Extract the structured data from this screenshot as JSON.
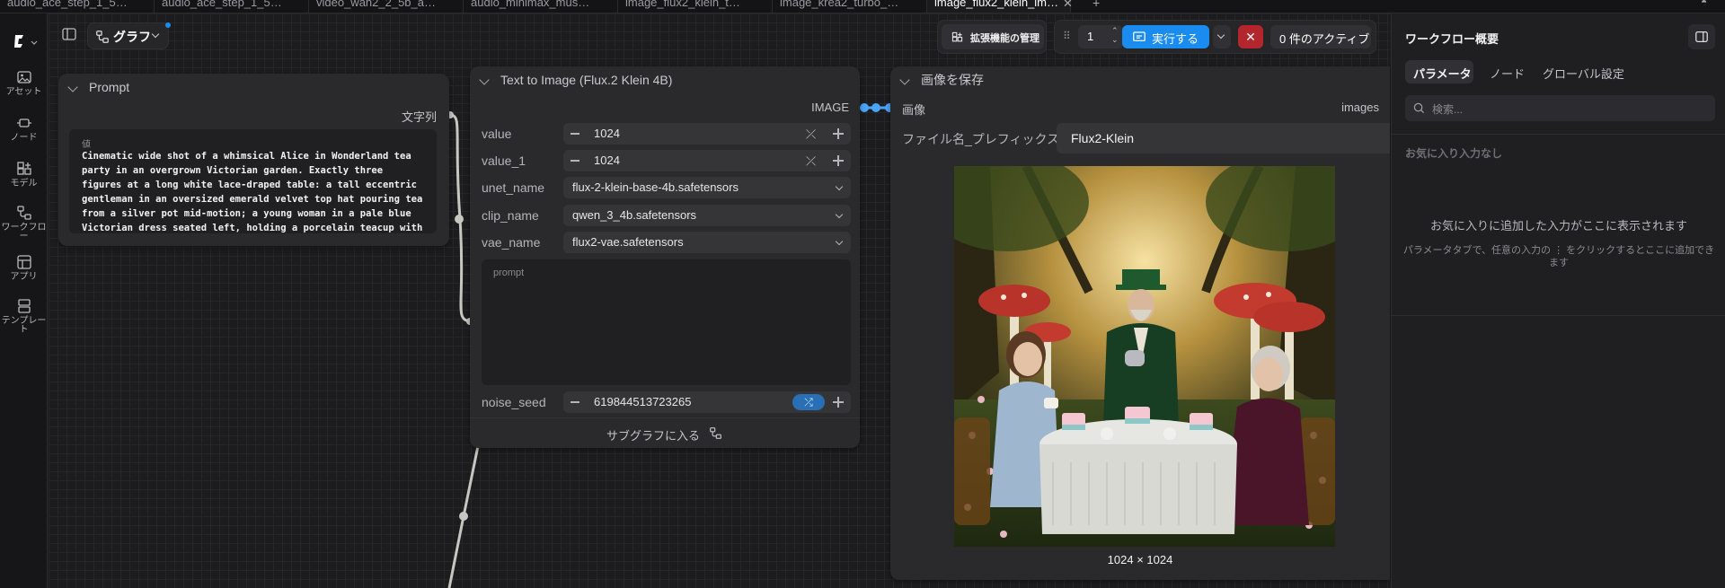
{
  "tabs": [
    {
      "label": "audio_ace_step_1_5…"
    },
    {
      "label": "audio_ace_step_1_5…"
    },
    {
      "label": "video_wan2_2_5b_a…"
    },
    {
      "label": "audio_minimax_mus…"
    },
    {
      "label": "image_flux2_klein_t…"
    },
    {
      "label": "image_krea2_turbo_…"
    },
    {
      "label": "image_flux2_klein_im…"
    }
  ],
  "sidebar": {
    "items": [
      {
        "label": "アセット",
        "icon": "image-icon"
      },
      {
        "label": "ノード",
        "icon": "node-icon"
      },
      {
        "label": "モデル",
        "icon": "model-icon"
      },
      {
        "label": "ワークフロー",
        "icon": "workflow-icon"
      },
      {
        "label": "アプリ",
        "icon": "app-icon"
      },
      {
        "label": "テンプレート",
        "icon": "template-icon"
      }
    ]
  },
  "toolbar": {
    "graph_label": "グラフ",
    "extensions_label": "拡張機能の管理",
    "queue_count": "1",
    "run_label": "実行する",
    "active_label": "0 件のアクティブ"
  },
  "prompt_node": {
    "title": "Prompt",
    "output_label": "文字列",
    "field_label": "値",
    "text": "Cinematic wide shot of a whimsical Alice in Wonderland tea party in an overgrown Victorian garden. Exactly three figures at a long white lace-draped table: a tall eccentric gentleman in an oversized emerald velvet top hat pouring tea from a silver pot mid-motion; a young woman in a pale blue Victorian dress seated left, holding a porcelain teacup with both hands, looking up and laughing; an older"
  },
  "t2i_node": {
    "title": "Text to Image (Flux.2 Klein 4B)",
    "output_label": "IMAGE",
    "value_label": "value",
    "value": "1024",
    "value1_label": "value_1",
    "value1": "1024",
    "unet_label": "unet_name",
    "unet": "flux-2-klein-base-4b.safetensors",
    "clip_label": "clip_name",
    "clip": "qwen_3_4b.safetensors",
    "vae_label": "vae_name",
    "vae": "flux2-vae.safetensors",
    "prompt_placeholder": "prompt",
    "seed_label": "noise_seed",
    "seed": "619844513723265",
    "subgraph_label": "サブグラフに入る"
  },
  "save_node": {
    "title": "画像を保存",
    "input_label": "画像",
    "output_label": "images",
    "prefix_label": "ファイル名_プレフィックス",
    "prefix": "Flux2-Klein",
    "image_size": "1024 × 1024"
  },
  "right_panel": {
    "title": "ワークフロー概要",
    "tabs": [
      "パラメータ",
      "ノード",
      "グローバル設定"
    ],
    "search_placeholder": "検索...",
    "empty_title": "お気に入り入力なし",
    "empty_msg": "お気に入りに追加した入力がここに表示されます",
    "hint": "パラメータタブで、任意の入力の ⋮ をクリックするとここに追加できます"
  },
  "colors": {
    "accent": "#1a8cf0",
    "danger": "#b3262e",
    "hat_green": "#1f5a2e"
  }
}
